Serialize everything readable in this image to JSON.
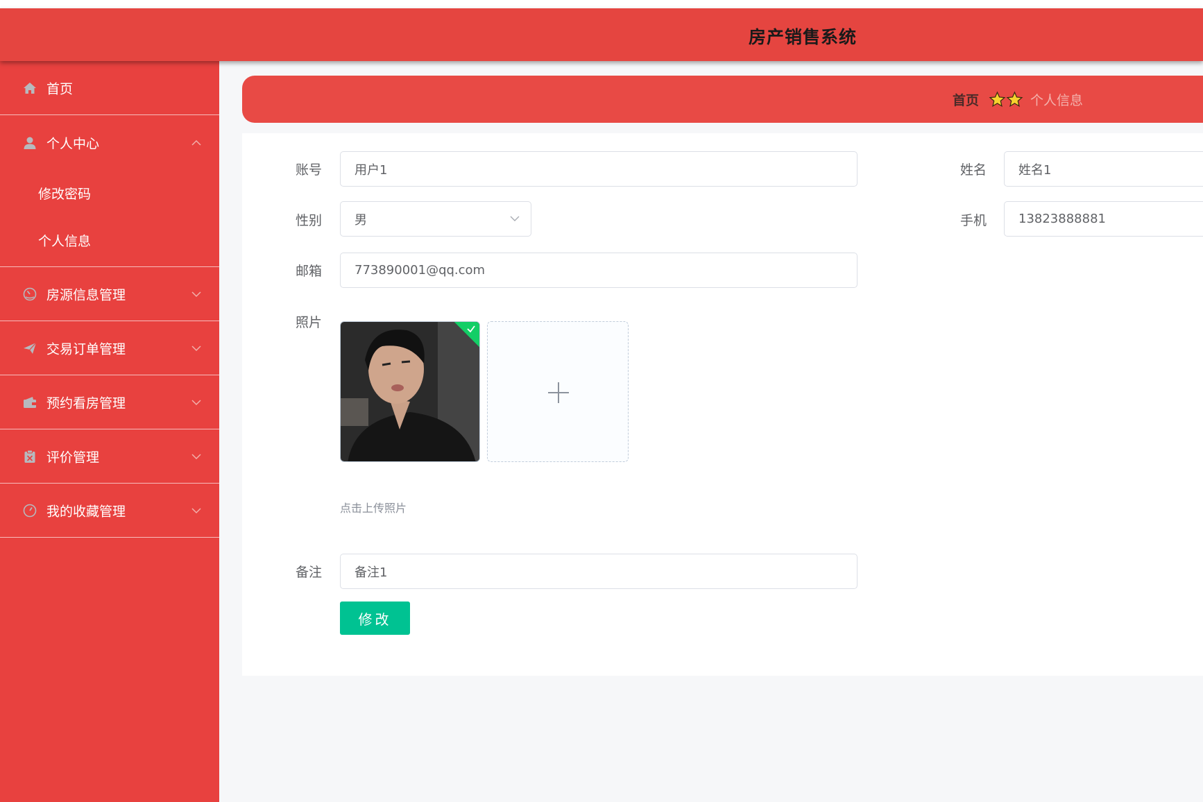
{
  "app": {
    "title": "房产销售系统"
  },
  "sidebar": {
    "items": [
      {
        "label": "首页",
        "icon": "home-icon"
      },
      {
        "label": "个人中心",
        "icon": "user-icon",
        "expanded": true,
        "children": [
          {
            "label": "修改密码"
          },
          {
            "label": "个人信息"
          }
        ]
      },
      {
        "label": "房源信息管理",
        "icon": "gauge-icon"
      },
      {
        "label": "交易订单管理",
        "icon": "send-icon"
      },
      {
        "label": "预约看房管理",
        "icon": "wallet-icon"
      },
      {
        "label": "评价管理",
        "icon": "clipboard-icon"
      },
      {
        "label": "我的收藏管理",
        "icon": "clock-icon"
      }
    ]
  },
  "breadcrumb": {
    "home": "首页",
    "current": "个人信息",
    "separator_icon": "star-icon"
  },
  "form": {
    "account_label": "账号",
    "account_value": "用户1",
    "name_label": "姓名",
    "name_value": "姓名1",
    "gender_label": "性别",
    "gender_value": "男",
    "phone_label": "手机",
    "phone_value": "13823888881",
    "email_label": "邮箱",
    "email_value": "773890001@qq.com",
    "photo_label": "照片",
    "photo_hint": "点击上传照片",
    "remark_label": "备注",
    "remark_value": "备注1",
    "submit_label": "修改"
  },
  "colors": {
    "primary": "#e8413f",
    "header": "#e54540",
    "success": "#13ce66",
    "button": "#00c292"
  }
}
